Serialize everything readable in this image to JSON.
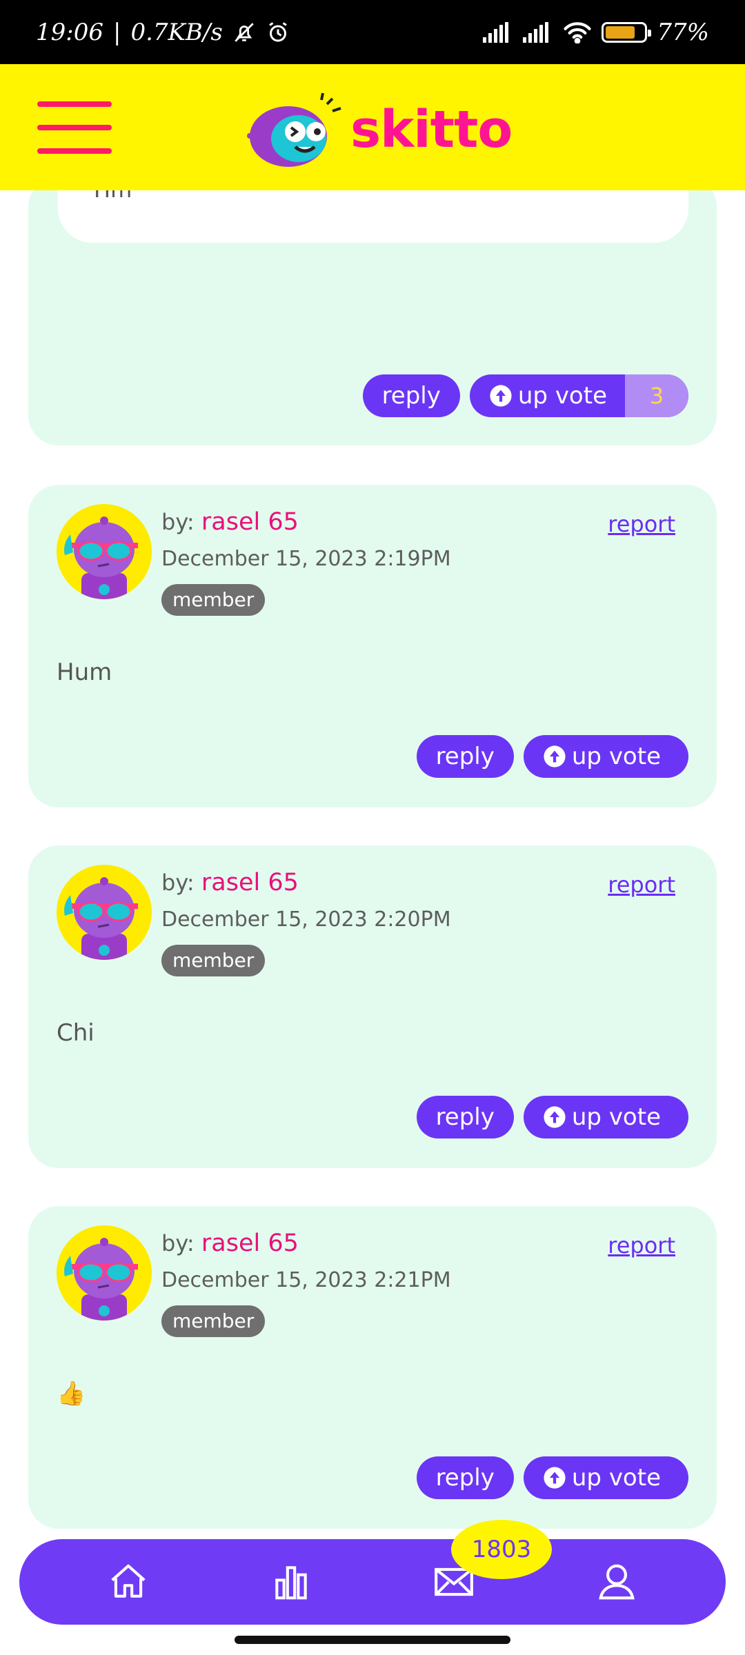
{
  "status_bar": {
    "time": "19:06",
    "speed": "0.7KB/s",
    "battery": "77%",
    "battery_level": 0.77
  },
  "header": {
    "logo_text": "skitto"
  },
  "top_card": {
    "quote_text": "Hm",
    "reply_label": "reply",
    "upvote_label": "up vote",
    "upvote_count": "3"
  },
  "comments": [
    {
      "by_label": "by:",
      "username": "rasel 65",
      "date": "December 15, 2023 2:19PM",
      "badge": "member",
      "report": "report",
      "text": "Hum",
      "reply_label": "reply",
      "upvote_label": "up vote"
    },
    {
      "by_label": "by:",
      "username": "rasel 65",
      "date": "December 15, 2023 2:20PM",
      "badge": "member",
      "report": "report",
      "text": "Chi",
      "reply_label": "reply",
      "upvote_label": "up vote"
    },
    {
      "by_label": "by:",
      "username": "rasel 65",
      "date": "December 15, 2023 2:21PM",
      "badge": "member",
      "report": "report",
      "text": "👍",
      "reply_label": "reply",
      "upvote_label": "up vote"
    }
  ],
  "bottom_nav": {
    "items": [
      "home-icon",
      "stats-icon",
      "mail-icon",
      "profile-icon"
    ],
    "mail_count": "1803"
  },
  "colors": {
    "accent": "#6b35f5",
    "header_bg": "#fff500",
    "card_bg": "#e3fbef",
    "username": "#e8107a"
  }
}
